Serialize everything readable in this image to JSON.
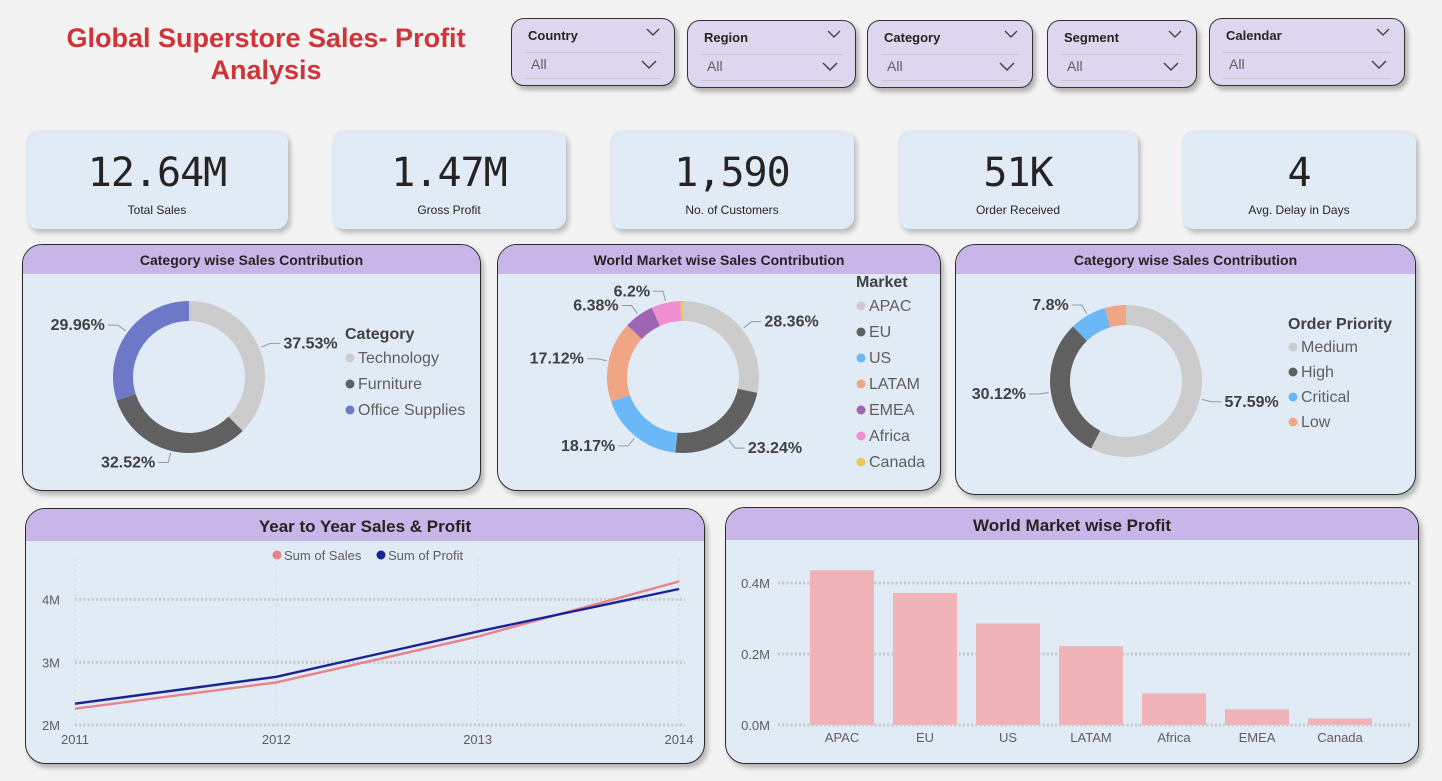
{
  "header": {
    "title": "Global Superstore Sales- Profit Analysis"
  },
  "slicers": [
    {
      "label": "Country",
      "value": "All"
    },
    {
      "label": "Region",
      "value": "All"
    },
    {
      "label": "Category",
      "value": "All"
    },
    {
      "label": "Segment",
      "value": "All"
    },
    {
      "label": "Calendar",
      "value": "All"
    }
  ],
  "kpis": [
    {
      "value": "12.64M",
      "label": "Total Sales"
    },
    {
      "value": "1.47M",
      "label": "Gross Profit"
    },
    {
      "value": "1,590",
      "label": "No. of Customers"
    },
    {
      "value": "51K",
      "label": "Order Received"
    },
    {
      "value": "4",
      "label": "Avg. Delay in Days"
    }
  ],
  "colors": {
    "title": "#d13438",
    "card_bg": "#e1ebf6",
    "header_bg": "#c7b6e7",
    "sales_line": "#e8838c",
    "profit_line": "#1a2394",
    "bar": "#f0b3b8"
  },
  "chart_data": [
    {
      "type": "pie",
      "title": "Category wise Sales Contribution",
      "legend_title": "Category",
      "legend_position": "right",
      "slices": [
        {
          "label": "Technology",
          "value": 37.53,
          "text": "37.53%",
          "color": "#cccccc"
        },
        {
          "label": "Furniture",
          "value": 32.52,
          "text": "32.52%",
          "color": "#606060"
        },
        {
          "label": "Office Supplies",
          "value": 29.96,
          "text": "29.96%",
          "color": "#6d78c8"
        }
      ]
    },
    {
      "type": "pie",
      "title": "World Market wise Sales Contribution",
      "legend_title": "Market",
      "legend_position": "right",
      "slices": [
        {
          "label": "APAC",
          "value": 28.36,
          "text": "28.36%",
          "color": "#cccccc"
        },
        {
          "label": "EU",
          "value": 23.24,
          "text": "23.24%",
          "color": "#606060"
        },
        {
          "label": "US",
          "value": 18.17,
          "text": "18.17%",
          "color": "#6ab8f7"
        },
        {
          "label": "LATAM",
          "value": 17.12,
          "text": "17.12%",
          "color": "#f0a585"
        },
        {
          "label": "EMEA",
          "value": 6.38,
          "text": "6.38%",
          "color": "#a064b4"
        },
        {
          "label": "Africa",
          "value": 6.2,
          "text": "6.2%",
          "color": "#ef8fcf"
        },
        {
          "label": "Canada",
          "value": 0.53,
          "text": "",
          "color": "#e8c95c"
        }
      ]
    },
    {
      "type": "pie",
      "title": "Category wise Sales Contribution",
      "legend_title": "Order Priority",
      "legend_position": "right",
      "slices": [
        {
          "label": "Medium",
          "value": 57.59,
          "text": "57.59%",
          "color": "#cccccc"
        },
        {
          "label": "High",
          "value": 30.12,
          "text": "30.12%",
          "color": "#606060"
        },
        {
          "label": "Critical",
          "value": 7.8,
          "text": "7.8%",
          "color": "#6ab8f7"
        },
        {
          "label": "Low",
          "value": 4.49,
          "text": "",
          "color": "#f0a585"
        }
      ]
    },
    {
      "type": "line",
      "title": "Year to Year Sales & Profit",
      "legend_position": "top-center",
      "x": [
        "2011",
        "2012",
        "2013",
        "2014"
      ],
      "series": [
        {
          "name": "Sum of Sales",
          "values": [
            2.26,
            2.68,
            3.41,
            4.29
          ],
          "color": "#e8838c"
        },
        {
          "name": "Sum of Profit",
          "values": [
            2.34,
            2.77,
            3.49,
            4.17
          ],
          "color": "#1a2394"
        }
      ],
      "yticks": [
        "2M",
        "3M",
        "4M"
      ],
      "ylim": [
        2,
        4.33
      ],
      "grid": true
    },
    {
      "type": "bar",
      "title": "World Market wise Profit",
      "categories": [
        "APAC",
        "EU",
        "US",
        "LATAM",
        "Africa",
        "EMEA",
        "Canada"
      ],
      "values": [
        0.436,
        0.372,
        0.286,
        0.222,
        0.089,
        0.044,
        0.018
      ],
      "yticks": [
        "0.0M",
        "0.2M",
        "0.4M"
      ],
      "ylim": [
        0,
        0.45
      ],
      "grid": true
    }
  ]
}
